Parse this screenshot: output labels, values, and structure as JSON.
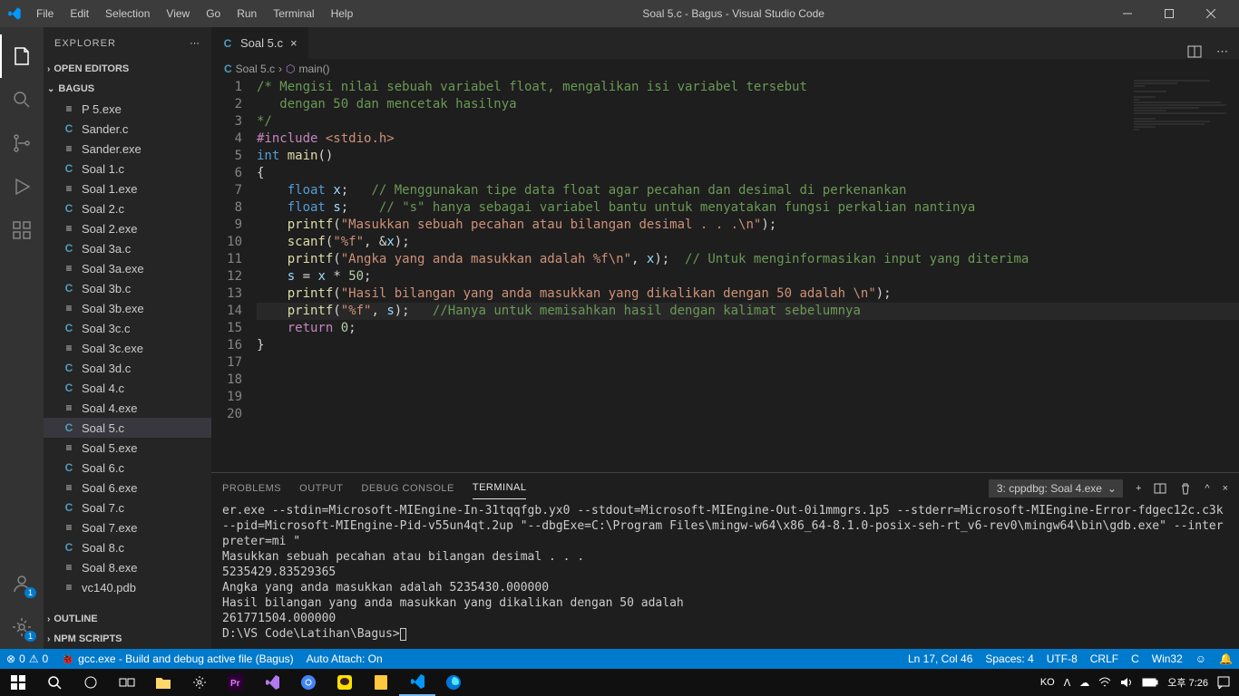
{
  "window": {
    "title": "Soal 5.c - Bagus - Visual Studio Code"
  },
  "menu": [
    "File",
    "Edit",
    "Selection",
    "View",
    "Go",
    "Run",
    "Terminal",
    "Help"
  ],
  "sidebar": {
    "title": "EXPLORER",
    "open_editors": "OPEN EDITORS",
    "folder": "BAGUS",
    "outline": "OUTLINE",
    "npm": "NPM SCRIPTS",
    "files": [
      {
        "icon": "exe",
        "name": "P 5.exe"
      },
      {
        "icon": "c",
        "name": "Sander.c"
      },
      {
        "icon": "exe",
        "name": "Sander.exe"
      },
      {
        "icon": "c",
        "name": "Soal 1.c"
      },
      {
        "icon": "exe",
        "name": "Soal 1.exe"
      },
      {
        "icon": "c",
        "name": "Soal 2.c"
      },
      {
        "icon": "exe",
        "name": "Soal 2.exe"
      },
      {
        "icon": "c",
        "name": "Soal 3a.c"
      },
      {
        "icon": "exe",
        "name": "Soal 3a.exe"
      },
      {
        "icon": "c",
        "name": "Soal 3b.c"
      },
      {
        "icon": "exe",
        "name": "Soal 3b.exe"
      },
      {
        "icon": "c",
        "name": "Soal 3c.c"
      },
      {
        "icon": "exe",
        "name": "Soal 3c.exe"
      },
      {
        "icon": "c",
        "name": "Soal 3d.c"
      },
      {
        "icon": "c",
        "name": "Soal 4.c"
      },
      {
        "icon": "exe",
        "name": "Soal 4.exe"
      },
      {
        "icon": "c",
        "name": "Soal 5.c",
        "active": true
      },
      {
        "icon": "exe",
        "name": "Soal 5.exe"
      },
      {
        "icon": "c",
        "name": "Soal 6.c"
      },
      {
        "icon": "exe",
        "name": "Soal 6.exe"
      },
      {
        "icon": "c",
        "name": "Soal 7.c"
      },
      {
        "icon": "exe",
        "name": "Soal 7.exe"
      },
      {
        "icon": "c",
        "name": "Soal 8.c"
      },
      {
        "icon": "exe",
        "name": "Soal 8.exe"
      },
      {
        "icon": "exe",
        "name": "vc140.pdb"
      }
    ]
  },
  "tab": {
    "label": "Soal 5.c"
  },
  "breadcrumb": {
    "file": "Soal 5.c",
    "symbol": "main()"
  },
  "code_lines": [
    1,
    2,
    3,
    4,
    5,
    6,
    7,
    8,
    9,
    10,
    11,
    12,
    13,
    14,
    15,
    16,
    17,
    18,
    19,
    20
  ],
  "panel": {
    "tabs": [
      "PROBLEMS",
      "OUTPUT",
      "DEBUG CONSOLE",
      "TERMINAL"
    ],
    "selector": "3: cppdbg: Soal 4.exe",
    "terminal": "er.exe --stdin=Microsoft-MIEngine-In-31tqqfgb.yx0 --stdout=Microsoft-MIEngine-Out-0i1mmgrs.1p5 --stderr=Microsoft-MIEngine-Error-fdgec12c.c3k --pid=Microsoft-MIEngine-Pid-v55un4qt.2up \"--dbgExe=C:\\Program Files\\mingw-w64\\x86_64-8.1.0-posix-seh-rt_v6-rev0\\mingw64\\bin\\gdb.exe\" --interpreter=mi \"\nMasukkan sebuah pecahan atau bilangan desimal . . .\n5235429.83529365\nAngka yang anda masukkan adalah 5235430.000000\nHasil bilangan yang anda masukkan yang dikalikan dengan 50 adalah\n261771504.000000\nD:\\VS Code\\Latihan\\Bagus>"
  },
  "status": {
    "errors": "0",
    "warnings": "0",
    "task": "gcc.exe - Build and debug active file (Bagus)",
    "auto_attach": "Auto Attach: On",
    "ln_col": "Ln 17, Col 46",
    "spaces": "Spaces: 4",
    "encoding": "UTF-8",
    "eol": "CRLF",
    "lang": "C",
    "os": "Win32",
    "bell": "🔔"
  },
  "taskbar": {
    "ime": "KO",
    "time": "오후 7:26"
  }
}
